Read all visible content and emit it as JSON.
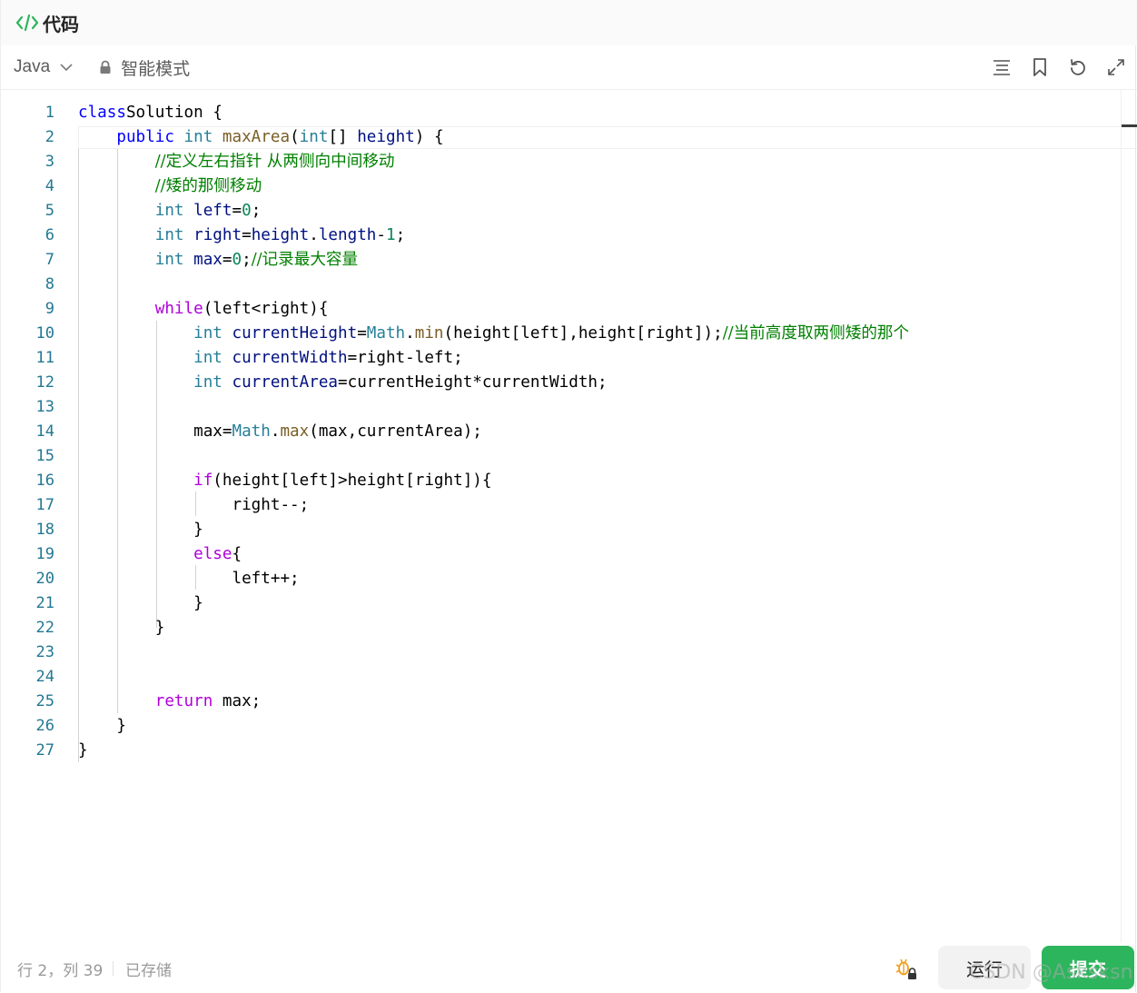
{
  "header": {
    "title": "代码",
    "icon": "code-icon"
  },
  "toolbar": {
    "language": "Java",
    "mode_label": "智能模式",
    "icons": [
      "format-icon",
      "bookmark-icon",
      "reset-icon",
      "fullscreen-icon"
    ]
  },
  "editor": {
    "lines": [
      [
        [
          "kw",
          "class"
        ],
        [
          "",
          "Solution",
          " "
        ],
        [
          "",
          "{"
        ]
      ],
      [
        [
          "",
          "    "
        ],
        [
          "kw",
          "public"
        ],
        [
          "",
          " "
        ],
        [
          "ty",
          "int"
        ],
        [
          "",
          " "
        ],
        [
          "fn",
          "maxArea"
        ],
        [
          "",
          "("
        ],
        [
          "ty",
          "int"
        ],
        [
          "",
          "[] "
        ],
        [
          "va",
          "height"
        ],
        [
          "",
          ") {"
        ]
      ],
      [
        [
          "",
          "        "
        ],
        [
          "cm",
          "//定义左右指针 从两侧向中间移动"
        ]
      ],
      [
        [
          "",
          "        "
        ],
        [
          "cm",
          "//矮的那侧移动"
        ]
      ],
      [
        [
          "",
          "        "
        ],
        [
          "ty",
          "int"
        ],
        [
          "",
          " "
        ],
        [
          "va",
          "left"
        ],
        [
          "",
          "="
        ],
        [
          "nu",
          "0"
        ],
        [
          "",
          ";"
        ]
      ],
      [
        [
          "",
          "        "
        ],
        [
          "ty",
          "int"
        ],
        [
          "",
          " "
        ],
        [
          "va",
          "right"
        ],
        [
          "",
          "="
        ],
        [
          "va",
          "height"
        ],
        [
          "",
          "."
        ],
        [
          "va",
          "length"
        ],
        [
          "",
          "-"
        ],
        [
          "nu",
          "1"
        ],
        [
          "",
          ";"
        ]
      ],
      [
        [
          "",
          "        "
        ],
        [
          "ty",
          "int"
        ],
        [
          "",
          " "
        ],
        [
          "va",
          "max"
        ],
        [
          "",
          "="
        ],
        [
          "nu",
          "0"
        ],
        [
          "",
          ";"
        ],
        [
          "cm",
          "//记录最大容量"
        ]
      ],
      [
        [
          "",
          ""
        ]
      ],
      [
        [
          "",
          "        "
        ],
        [
          "kw2",
          "while"
        ],
        [
          "",
          "(left<right){"
        ]
      ],
      [
        [
          "",
          "            "
        ],
        [
          "ty",
          "int"
        ],
        [
          "",
          " "
        ],
        [
          "va",
          "currentHeight"
        ],
        [
          "",
          "="
        ],
        [
          "ty",
          "Math"
        ],
        [
          "",
          "."
        ],
        [
          "fn",
          "min"
        ],
        [
          "",
          "(height[left],height[right]);"
        ],
        [
          "cm",
          "//当前高度取两侧矮的那个"
        ]
      ],
      [
        [
          "",
          "            "
        ],
        [
          "ty",
          "int"
        ],
        [
          "",
          " "
        ],
        [
          "va",
          "currentWidth"
        ],
        [
          "",
          "=right-left;"
        ]
      ],
      [
        [
          "",
          "            "
        ],
        [
          "ty",
          "int"
        ],
        [
          "",
          " "
        ],
        [
          "va",
          "currentArea"
        ],
        [
          "",
          "=currentHeight*currentWidth;"
        ]
      ],
      [
        [
          "",
          ""
        ]
      ],
      [
        [
          "",
          "            max="
        ],
        [
          "ty",
          "Math"
        ],
        [
          "",
          "."
        ],
        [
          "fn",
          "max"
        ],
        [
          "",
          "(max,currentArea);"
        ]
      ],
      [
        [
          "",
          ""
        ]
      ],
      [
        [
          "",
          "            "
        ],
        [
          "kw2",
          "if"
        ],
        [
          "",
          "(height[left]>height[right]){"
        ]
      ],
      [
        [
          "",
          "                right--;"
        ]
      ],
      [
        [
          "",
          "            }"
        ]
      ],
      [
        [
          "",
          "            "
        ],
        [
          "kw2",
          "else"
        ],
        [
          "",
          "{"
        ]
      ],
      [
        [
          "",
          "                left++;"
        ]
      ],
      [
        [
          "",
          "            }"
        ]
      ],
      [
        [
          "",
          "        }"
        ]
      ],
      [
        [
          "",
          ""
        ]
      ],
      [
        [
          "",
          ""
        ]
      ],
      [
        [
          "",
          "        "
        ],
        [
          "kw2",
          "return"
        ],
        [
          "",
          " max;"
        ]
      ],
      [
        [
          "",
          "    }"
        ]
      ],
      [
        [
          "",
          "}"
        ]
      ]
    ]
  },
  "status": {
    "position": "行 2，列 39",
    "saved": "已存储",
    "run_label": "运行",
    "submit_label": "提交",
    "watermark": "CSDN @Asksksn"
  },
  "colors": {
    "keyword": "#0000ff",
    "control_keyword": "#af00db",
    "type": "#267f99",
    "variable": "#001080",
    "function": "#795e26",
    "number": "#098658",
    "comment": "#008000",
    "line_number": "#237893",
    "submit": "#2db55d"
  }
}
